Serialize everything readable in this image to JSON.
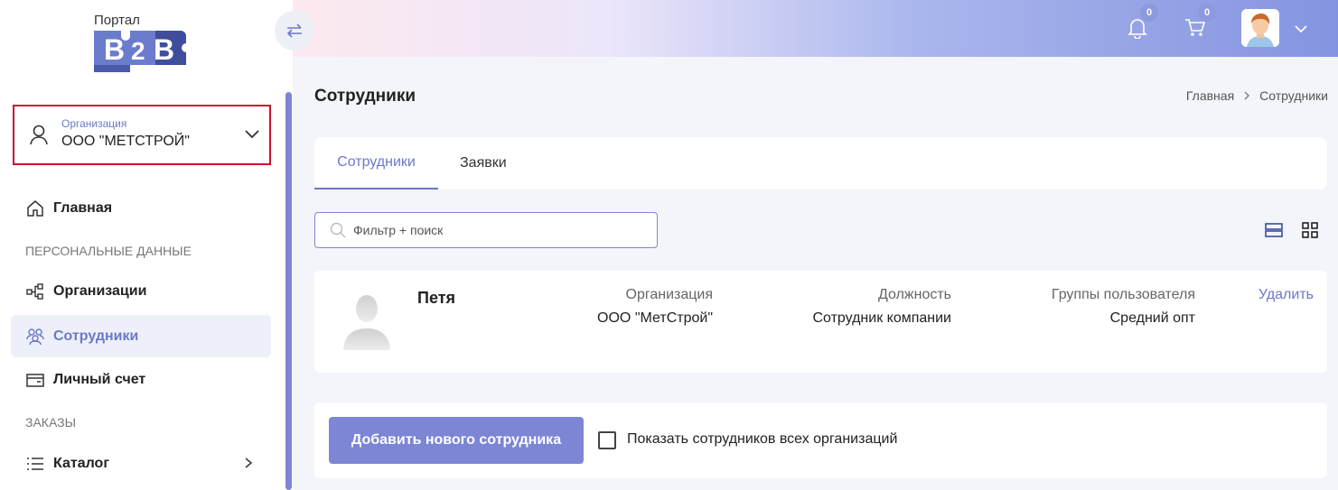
{
  "logo": {
    "title": "Портал",
    "brand": "B2B"
  },
  "organization": {
    "caption": "Организация",
    "value": "ООО \"МЕТСТРОЙ\""
  },
  "nav": {
    "home": "Главная",
    "section_personal": "ПЕРСОНАЛЬНЫЕ ДАННЫЕ",
    "organizations": "Организации",
    "employees": "Сотрудники",
    "account": "Личный счет",
    "section_orders": "ЗАКАЗЫ",
    "catalog": "Каталог"
  },
  "header": {
    "notifications_count": "0",
    "cart_count": "0"
  },
  "page": {
    "title": "Сотрудники"
  },
  "breadcrumb": {
    "home": "Главная",
    "separator": ">",
    "current": "Сотрудники"
  },
  "tabs": [
    {
      "label": "Сотрудники"
    },
    {
      "label": "Заявки"
    }
  ],
  "search": {
    "placeholder": "Фильтр + поиск",
    "value": ""
  },
  "employee": {
    "name": "Петя",
    "org_label": "Организация",
    "org_value": "ООО \"МетСтрой\"",
    "position_label": "Должность",
    "position_value": "Сотрудник компании",
    "groups_label": "Группы пользователя",
    "groups_value": "Средний опт",
    "delete_label": "Удалить"
  },
  "footer": {
    "add_button": "Добавить нового сотрудника",
    "show_all_label": "Показать сотрудников всех организаций",
    "show_all_checked": false
  },
  "colors": {
    "accent": "#6c78c9",
    "button": "#7c86d5",
    "highlight_border": "#c8102e"
  }
}
